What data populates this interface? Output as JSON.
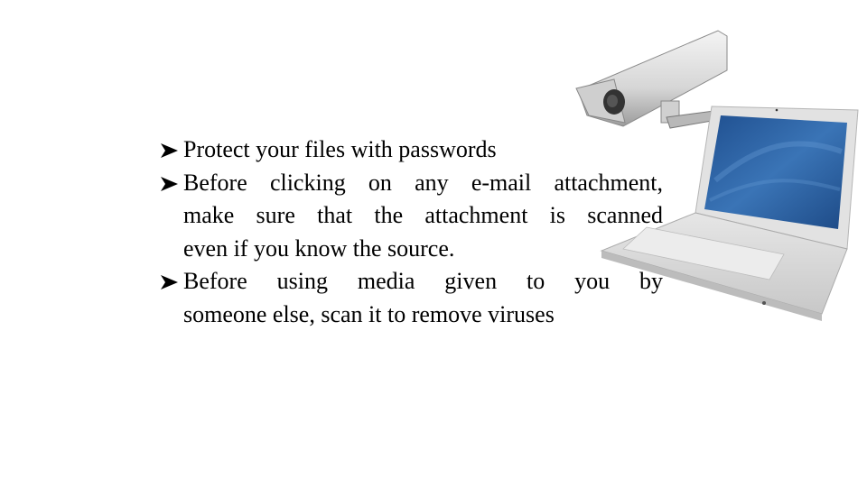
{
  "slide": {
    "bullets": [
      {
        "lines": [
          "Protect your files with passwords"
        ]
      },
      {
        "lines": [
          "Before clicking on any e-mail attachment,",
          "make sure that the attachment is scanned",
          "even if you know the source."
        ]
      },
      {
        "lines": [
          "Before using media given to you by",
          "someone else, scan it to remove viruses"
        ]
      }
    ],
    "bullet_icon": "arrowhead-bullet-icon",
    "illustration": "security-camera-and-laptop",
    "colors": {
      "text": "#000000",
      "background": "#ffffff",
      "screen_blue": "#2a5fa0",
      "device_gray": "#d8d8d8"
    }
  }
}
